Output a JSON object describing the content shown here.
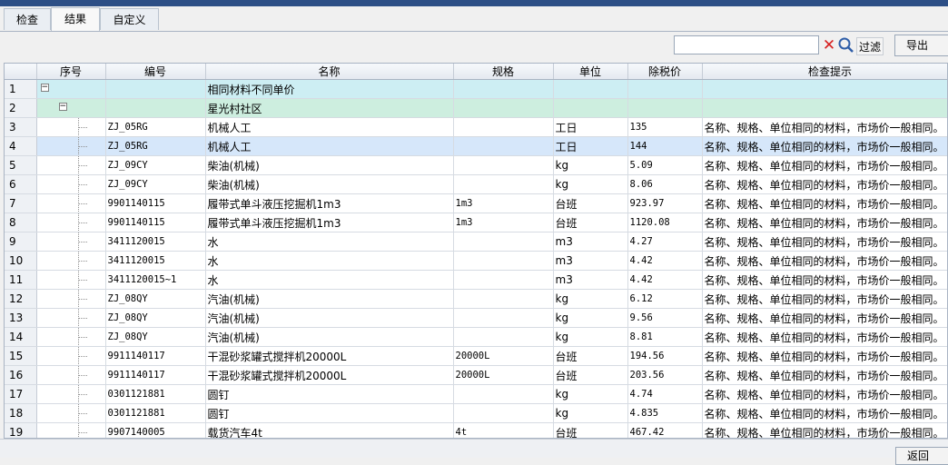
{
  "tabs": [
    {
      "label": "检查",
      "active": false
    },
    {
      "label": "结果",
      "active": true
    },
    {
      "label": "自定义",
      "active": false
    }
  ],
  "toolbar": {
    "search_value": "",
    "filter_label": "过滤",
    "export_label": "导出"
  },
  "columns": [
    "序号",
    "编号",
    "名称",
    "规格",
    "单位",
    "除税价",
    "检查提示"
  ],
  "groups": {
    "level1": {
      "seq": "1",
      "name": "相同材料不同单价"
    },
    "level2": {
      "seq": "2",
      "name": "星光村社区"
    }
  },
  "rows": [
    {
      "seq": "3",
      "code": "ZJ_05RG",
      "name": "机械人工",
      "spec": "",
      "unit": "工日",
      "price": "135",
      "hint": "名称、规格、单位相同的材料，市场价一般相同。"
    },
    {
      "seq": "4",
      "code": "ZJ_05RG",
      "name": "机械人工",
      "spec": "",
      "unit": "工日",
      "price": "144",
      "hint": "名称、规格、单位相同的材料，市场价一般相同。",
      "selected": true
    },
    {
      "seq": "5",
      "code": "ZJ_09CY",
      "name": "柴油(机械)",
      "spec": "",
      "unit": "kg",
      "price": "5.09",
      "hint": "名称、规格、单位相同的材料，市场价一般相同。"
    },
    {
      "seq": "6",
      "code": "ZJ_09CY",
      "name": "柴油(机械)",
      "spec": "",
      "unit": "kg",
      "price": "8.06",
      "hint": "名称、规格、单位相同的材料，市场价一般相同。"
    },
    {
      "seq": "7",
      "code": "9901140115",
      "name": "履带式单斗液压挖掘机1m3",
      "spec": "1m3",
      "unit": "台班",
      "price": "923.97",
      "hint": "名称、规格、单位相同的材料，市场价一般相同。"
    },
    {
      "seq": "8",
      "code": "9901140115",
      "name": "履带式单斗液压挖掘机1m3",
      "spec": "1m3",
      "unit": "台班",
      "price": "1120.08",
      "hint": "名称、规格、单位相同的材料，市场价一般相同。"
    },
    {
      "seq": "9",
      "code": "3411120015",
      "name": "水",
      "spec": "",
      "unit": "m3",
      "price": "4.27",
      "hint": "名称、规格、单位相同的材料，市场价一般相同。"
    },
    {
      "seq": "10",
      "code": "3411120015",
      "name": "水",
      "spec": "",
      "unit": "m3",
      "price": "4.42",
      "hint": "名称、规格、单位相同的材料，市场价一般相同。"
    },
    {
      "seq": "11",
      "code": "3411120015~1",
      "name": "水",
      "spec": "",
      "unit": "m3",
      "price": "4.42",
      "hint": "名称、规格、单位相同的材料，市场价一般相同。"
    },
    {
      "seq": "12",
      "code": "ZJ_08QY",
      "name": "汽油(机械)",
      "spec": "",
      "unit": "kg",
      "price": "6.12",
      "hint": "名称、规格、单位相同的材料，市场价一般相同。"
    },
    {
      "seq": "13",
      "code": "ZJ_08QY",
      "name": "汽油(机械)",
      "spec": "",
      "unit": "kg",
      "price": "9.56",
      "hint": "名称、规格、单位相同的材料，市场价一般相同。"
    },
    {
      "seq": "14",
      "code": "ZJ_08QY",
      "name": "汽油(机械)",
      "spec": "",
      "unit": "kg",
      "price": "8.81",
      "hint": "名称、规格、单位相同的材料，市场价一般相同。"
    },
    {
      "seq": "15",
      "code": "9911140117",
      "name": "干混砂浆罐式搅拌机20000L",
      "spec": "20000L",
      "unit": "台班",
      "price": "194.56",
      "hint": "名称、规格、单位相同的材料，市场价一般相同。"
    },
    {
      "seq": "16",
      "code": "9911140117",
      "name": "干混砂浆罐式搅拌机20000L",
      "spec": "20000L",
      "unit": "台班",
      "price": "203.56",
      "hint": "名称、规格、单位相同的材料，市场价一般相同。"
    },
    {
      "seq": "17",
      "code": "0301121881",
      "name": "圆钉",
      "spec": "",
      "unit": "kg",
      "price": "4.74",
      "hint": "名称、规格、单位相同的材料，市场价一般相同。"
    },
    {
      "seq": "18",
      "code": "0301121881",
      "name": "圆钉",
      "spec": "",
      "unit": "kg",
      "price": "4.835",
      "hint": "名称、规格、单位相同的材料，市场价一般相同。"
    },
    {
      "seq": "19",
      "code": "9907140005",
      "name": "载货汽车4t",
      "spec": "4t",
      "unit": "台班",
      "price": "467.42",
      "hint": "名称、规格、单位相同的材料，市场价一般相同。"
    }
  ],
  "footer": {
    "back_label": "返回"
  },
  "colors": {
    "accent": "#2d4f86",
    "group1_bg": "#cdeef3",
    "group2_bg": "#cdeedf",
    "selected_bg": "#d6e7fa",
    "clear_red": "#d61f1f"
  }
}
